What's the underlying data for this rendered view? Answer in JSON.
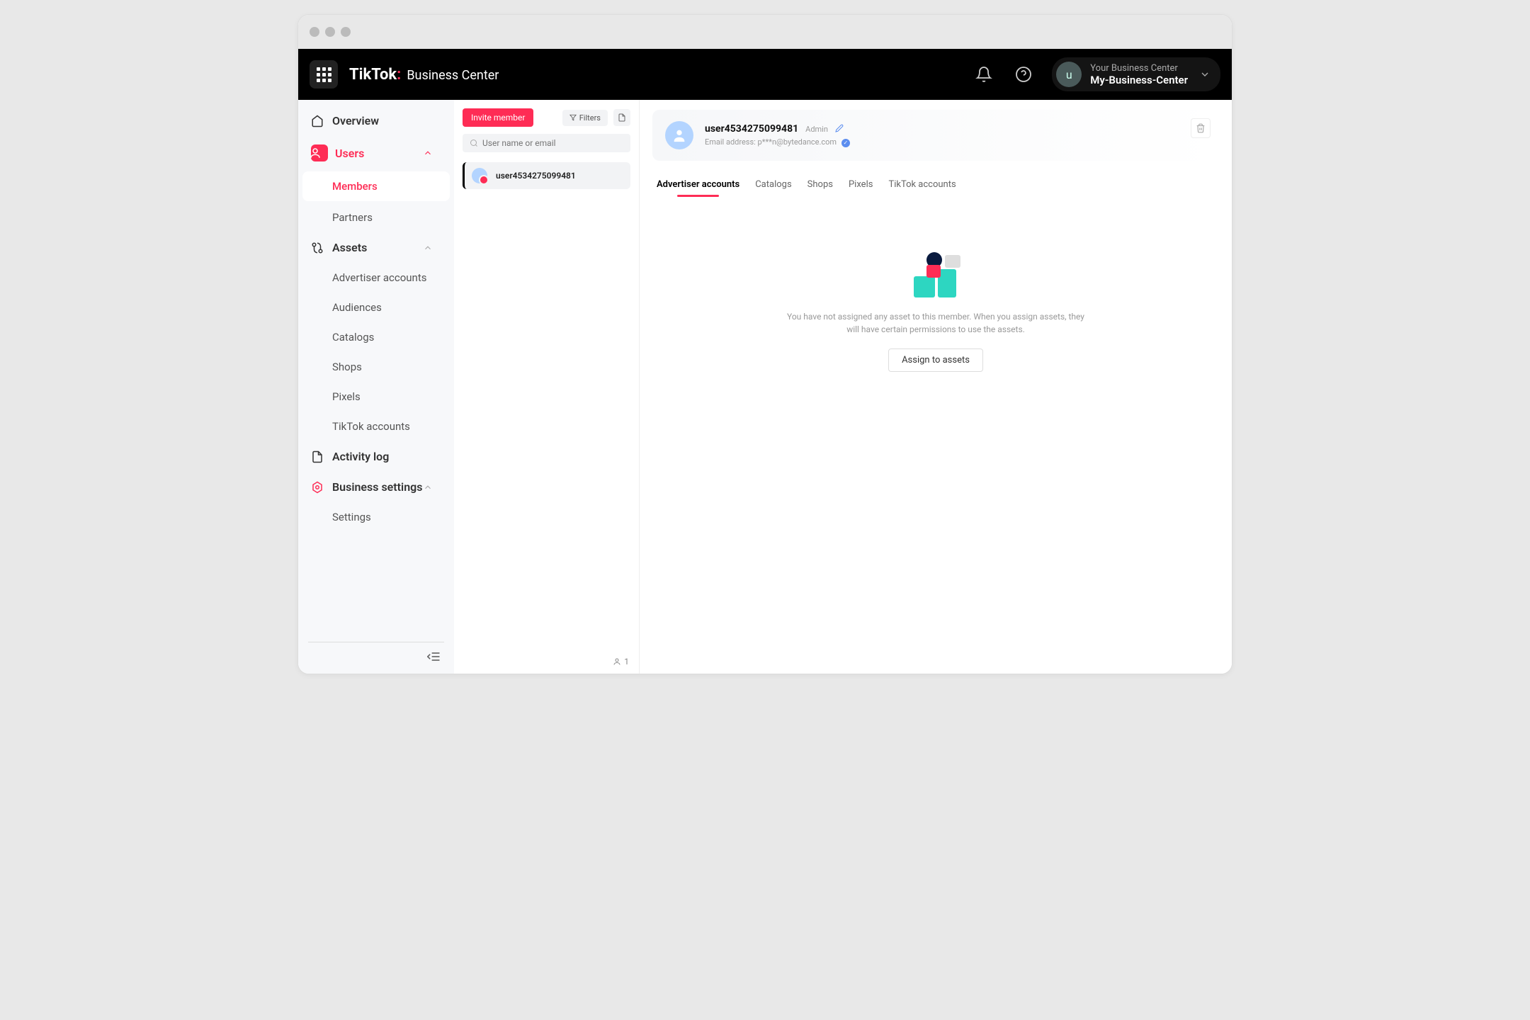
{
  "header": {
    "logo_primary": "TikTok",
    "logo_suffix": "Business Center",
    "account_label": "Your Business Center",
    "account_name": "My-Business-Center",
    "avatar_letter": "u"
  },
  "sidebar": {
    "overview": "Overview",
    "users": "Users",
    "members": "Members",
    "partners": "Partners",
    "assets": "Assets",
    "advertiser_accounts": "Advertiser accounts",
    "audiences": "Audiences",
    "catalogs": "Catalogs",
    "shops": "Shops",
    "pixels": "Pixels",
    "tiktok_accounts": "TikTok accounts",
    "activity_log": "Activity log",
    "business_settings": "Business settings",
    "settings": "Settings"
  },
  "members_col": {
    "invite_label": "Invite member",
    "filters_label": "Filters",
    "search_placeholder": "User name or email",
    "selected_member": "user4534275099481",
    "count": "1"
  },
  "detail": {
    "user_name": "user4534275099481",
    "role": "Admin",
    "email_label": "Email address: p***n@bytedance.com",
    "tabs": {
      "advertiser": "Advertiser accounts",
      "catalogs": "Catalogs",
      "shops": "Shops",
      "pixels": "Pixels",
      "tiktok": "TikTok accounts"
    },
    "empty_text": "You have not assigned any asset to this member. When you assign assets, they will have certain permissions to use the assets.",
    "assign_label": "Assign to assets"
  }
}
